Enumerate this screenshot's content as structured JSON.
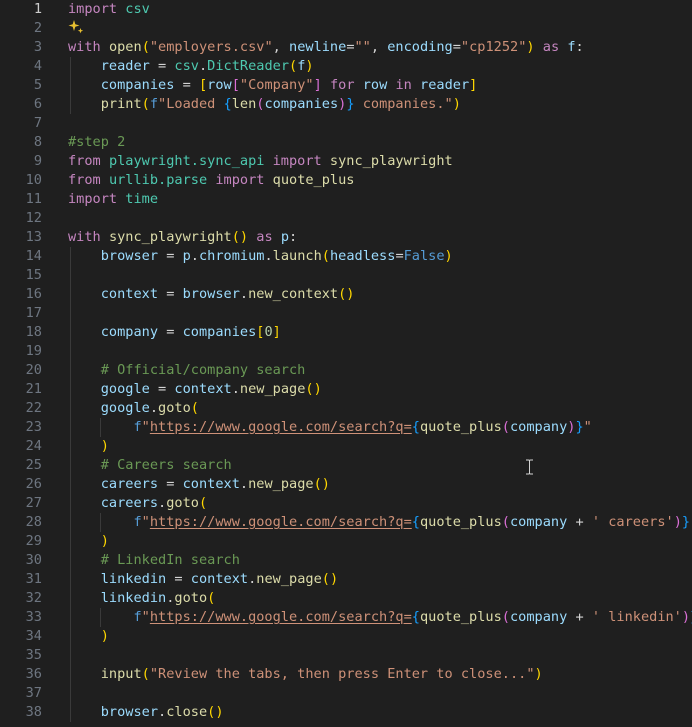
{
  "editor": {
    "colors": {
      "background": "#1f1f1f",
      "keyword": "#c586c0",
      "control": "#569cd6",
      "variable": "#9cdcfe",
      "function": "#dcdcaa",
      "string": "#ce9178",
      "comment": "#6a9955",
      "number": "#b5cea8",
      "module": "#4ec9b0",
      "bracket_gold": "#ffd700",
      "bracket_pink": "#da70d6",
      "bracket_blue": "#179fff"
    },
    "line_numbers": [
      "1",
      "2",
      "3",
      "4",
      "5",
      "6",
      "7",
      "8",
      "9",
      "10",
      "11",
      "12",
      "13",
      "14",
      "15",
      "16",
      "17",
      "18",
      "19",
      "20",
      "21",
      "22",
      "23",
      "24",
      "25",
      "26",
      "27",
      "28",
      "29",
      "30",
      "31",
      "32",
      "33",
      "34",
      "35",
      "36",
      "37",
      "38"
    ],
    "active_line": 1,
    "sparkle_icon": "ai-sparkle-icon",
    "lines": [
      [
        [
          "kw",
          "import"
        ],
        [
          "pl",
          " "
        ],
        [
          "md",
          "csv"
        ]
      ],
      [],
      [
        [
          "kw",
          "with"
        ],
        [
          "pl",
          " "
        ],
        [
          "fn",
          "open"
        ],
        [
          "b1",
          "("
        ],
        [
          "st",
          "\"employers.csv\""
        ],
        [
          "pl",
          ", "
        ],
        [
          "pa",
          "newline"
        ],
        [
          "pl",
          "="
        ],
        [
          "st",
          "\"\""
        ],
        [
          "pl",
          ", "
        ],
        [
          "pa",
          "encoding"
        ],
        [
          "pl",
          "="
        ],
        [
          "st",
          "\"cp1252\""
        ],
        [
          "b1",
          ")"
        ],
        [
          "pl",
          " "
        ],
        [
          "kw",
          "as"
        ],
        [
          "pl",
          " "
        ],
        [
          "va",
          "f"
        ],
        [
          "pl",
          ":"
        ]
      ],
      [
        [
          "pl",
          "    "
        ],
        [
          "va",
          "reader"
        ],
        [
          "pl",
          " = "
        ],
        [
          "md",
          "csv"
        ],
        [
          "pl",
          "."
        ],
        [
          "md",
          "DictReader"
        ],
        [
          "b1",
          "("
        ],
        [
          "va",
          "f"
        ],
        [
          "b1",
          ")"
        ]
      ],
      [
        [
          "pl",
          "    "
        ],
        [
          "va",
          "companies"
        ],
        [
          "pl",
          " = "
        ],
        [
          "b1",
          "["
        ],
        [
          "va",
          "row"
        ],
        [
          "b2",
          "["
        ],
        [
          "st",
          "\"Company\""
        ],
        [
          "b2",
          "]"
        ],
        [
          "pl",
          " "
        ],
        [
          "kw",
          "for"
        ],
        [
          "pl",
          " "
        ],
        [
          "va",
          "row"
        ],
        [
          "pl",
          " "
        ],
        [
          "kw",
          "in"
        ],
        [
          "pl",
          " "
        ],
        [
          "va",
          "reader"
        ],
        [
          "b1",
          "]"
        ]
      ],
      [
        [
          "pl",
          "    "
        ],
        [
          "fn",
          "print"
        ],
        [
          "b1",
          "("
        ],
        [
          "ct",
          "f"
        ],
        [
          "st",
          "\"Loaded "
        ],
        [
          "cb",
          "{"
        ],
        [
          "fn",
          "len"
        ],
        [
          "b2",
          "("
        ],
        [
          "va",
          "companies"
        ],
        [
          "b2",
          ")"
        ],
        [
          "cb",
          "}"
        ],
        [
          "st",
          " companies.\""
        ],
        [
          "b1",
          ")"
        ]
      ],
      [],
      [
        [
          "cm",
          "#step 2"
        ]
      ],
      [
        [
          "kw",
          "from"
        ],
        [
          "pl",
          " "
        ],
        [
          "md",
          "playwright.sync_api"
        ],
        [
          "pl",
          " "
        ],
        [
          "kw",
          "import"
        ],
        [
          "pl",
          " "
        ],
        [
          "fn",
          "sync_playwright"
        ]
      ],
      [
        [
          "kw",
          "from"
        ],
        [
          "pl",
          " "
        ],
        [
          "md",
          "urllib.parse"
        ],
        [
          "pl",
          " "
        ],
        [
          "kw",
          "import"
        ],
        [
          "pl",
          " "
        ],
        [
          "fn",
          "quote_plus"
        ]
      ],
      [
        [
          "kw",
          "import"
        ],
        [
          "pl",
          " "
        ],
        [
          "md",
          "time"
        ]
      ],
      [],
      [
        [
          "kw",
          "with"
        ],
        [
          "pl",
          " "
        ],
        [
          "fn",
          "sync_playwright"
        ],
        [
          "b1",
          "()"
        ],
        [
          "pl",
          " "
        ],
        [
          "kw",
          "as"
        ],
        [
          "pl",
          " "
        ],
        [
          "va",
          "p"
        ],
        [
          "pl",
          ":"
        ]
      ],
      [
        [
          "pl",
          "    "
        ],
        [
          "va",
          "browser"
        ],
        [
          "pl",
          " = "
        ],
        [
          "va",
          "p"
        ],
        [
          "pl",
          "."
        ],
        [
          "va",
          "chromium"
        ],
        [
          "pl",
          "."
        ],
        [
          "fn",
          "launch"
        ],
        [
          "b1",
          "("
        ],
        [
          "pa",
          "headless"
        ],
        [
          "pl",
          "="
        ],
        [
          "ct",
          "False"
        ],
        [
          "b1",
          ")"
        ]
      ],
      [],
      [
        [
          "pl",
          "    "
        ],
        [
          "va",
          "context"
        ],
        [
          "pl",
          " = "
        ],
        [
          "va",
          "browser"
        ],
        [
          "pl",
          "."
        ],
        [
          "fn",
          "new_context"
        ],
        [
          "b1",
          "()"
        ]
      ],
      [],
      [
        [
          "pl",
          "    "
        ],
        [
          "va",
          "company"
        ],
        [
          "pl",
          " = "
        ],
        [
          "va",
          "companies"
        ],
        [
          "b1",
          "["
        ],
        [
          "nu",
          "0"
        ],
        [
          "b1",
          "]"
        ]
      ],
      [],
      [
        [
          "pl",
          "    "
        ],
        [
          "cm",
          "# Official/company search"
        ]
      ],
      [
        [
          "pl",
          "    "
        ],
        [
          "va",
          "google"
        ],
        [
          "pl",
          " = "
        ],
        [
          "va",
          "context"
        ],
        [
          "pl",
          "."
        ],
        [
          "fn",
          "new_page"
        ],
        [
          "b1",
          "()"
        ]
      ],
      [
        [
          "pl",
          "    "
        ],
        [
          "va",
          "google"
        ],
        [
          "pl",
          "."
        ],
        [
          "fn",
          "goto"
        ],
        [
          "b1",
          "("
        ]
      ],
      [
        [
          "pl",
          "        "
        ],
        [
          "ct",
          "f"
        ],
        [
          "st",
          "\""
        ],
        [
          "su",
          "https://www.google.com/search?q="
        ],
        [
          "cb",
          "{"
        ],
        [
          "fn",
          "quote_plus"
        ],
        [
          "b2",
          "("
        ],
        [
          "va",
          "company"
        ],
        [
          "b2",
          ")"
        ],
        [
          "cb",
          "}"
        ],
        [
          "st",
          "\""
        ]
      ],
      [
        [
          "pl",
          "    "
        ],
        [
          "b1",
          ")"
        ]
      ],
      [
        [
          "pl",
          "    "
        ],
        [
          "cm",
          "# Careers search"
        ]
      ],
      [
        [
          "pl",
          "    "
        ],
        [
          "va",
          "careers"
        ],
        [
          "pl",
          " = "
        ],
        [
          "va",
          "context"
        ],
        [
          "pl",
          "."
        ],
        [
          "fn",
          "new_page"
        ],
        [
          "b1",
          "()"
        ]
      ],
      [
        [
          "pl",
          "    "
        ],
        [
          "va",
          "careers"
        ],
        [
          "pl",
          "."
        ],
        [
          "fn",
          "goto"
        ],
        [
          "b1",
          "("
        ]
      ],
      [
        [
          "pl",
          "        "
        ],
        [
          "ct",
          "f"
        ],
        [
          "st",
          "\""
        ],
        [
          "su",
          "https://www.google.com/search?q="
        ],
        [
          "cb",
          "{"
        ],
        [
          "fn",
          "quote_plus"
        ],
        [
          "b2",
          "("
        ],
        [
          "va",
          "company"
        ],
        [
          "pl",
          " + "
        ],
        [
          "st",
          "' careers'"
        ],
        [
          "b2",
          ")"
        ],
        [
          "cb",
          "}"
        ],
        [
          "st",
          "\""
        ]
      ],
      [
        [
          "pl",
          "    "
        ],
        [
          "b1",
          ")"
        ]
      ],
      [
        [
          "pl",
          "    "
        ],
        [
          "cm",
          "# LinkedIn search"
        ]
      ],
      [
        [
          "pl",
          "    "
        ],
        [
          "va",
          "linkedin"
        ],
        [
          "pl",
          " = "
        ],
        [
          "va",
          "context"
        ],
        [
          "pl",
          "."
        ],
        [
          "fn",
          "new_page"
        ],
        [
          "b1",
          "()"
        ]
      ],
      [
        [
          "pl",
          "    "
        ],
        [
          "va",
          "linkedin"
        ],
        [
          "pl",
          "."
        ],
        [
          "fn",
          "goto"
        ],
        [
          "b1",
          "("
        ]
      ],
      [
        [
          "pl",
          "        "
        ],
        [
          "ct",
          "f"
        ],
        [
          "st",
          "\""
        ],
        [
          "su",
          "https://www.google.com/search?q="
        ],
        [
          "cb",
          "{"
        ],
        [
          "fn",
          "quote_plus"
        ],
        [
          "b2",
          "("
        ],
        [
          "va",
          "company"
        ],
        [
          "pl",
          " + "
        ],
        [
          "st",
          "' linkedin'"
        ],
        [
          "b2",
          ")"
        ],
        [
          "cb",
          "}"
        ],
        [
          "st",
          "\""
        ]
      ],
      [
        [
          "pl",
          "    "
        ],
        [
          "b1",
          ")"
        ]
      ],
      [],
      [
        [
          "pl",
          "    "
        ],
        [
          "fn",
          "input"
        ],
        [
          "b1",
          "("
        ],
        [
          "st",
          "\"Review the tabs, then press Enter to close...\""
        ],
        [
          "b1",
          ")"
        ]
      ],
      [],
      [
        [
          "pl",
          "    "
        ],
        [
          "va",
          "browser"
        ],
        [
          "pl",
          "."
        ],
        [
          "fn",
          "close"
        ],
        [
          "b1",
          "()"
        ]
      ]
    ]
  }
}
